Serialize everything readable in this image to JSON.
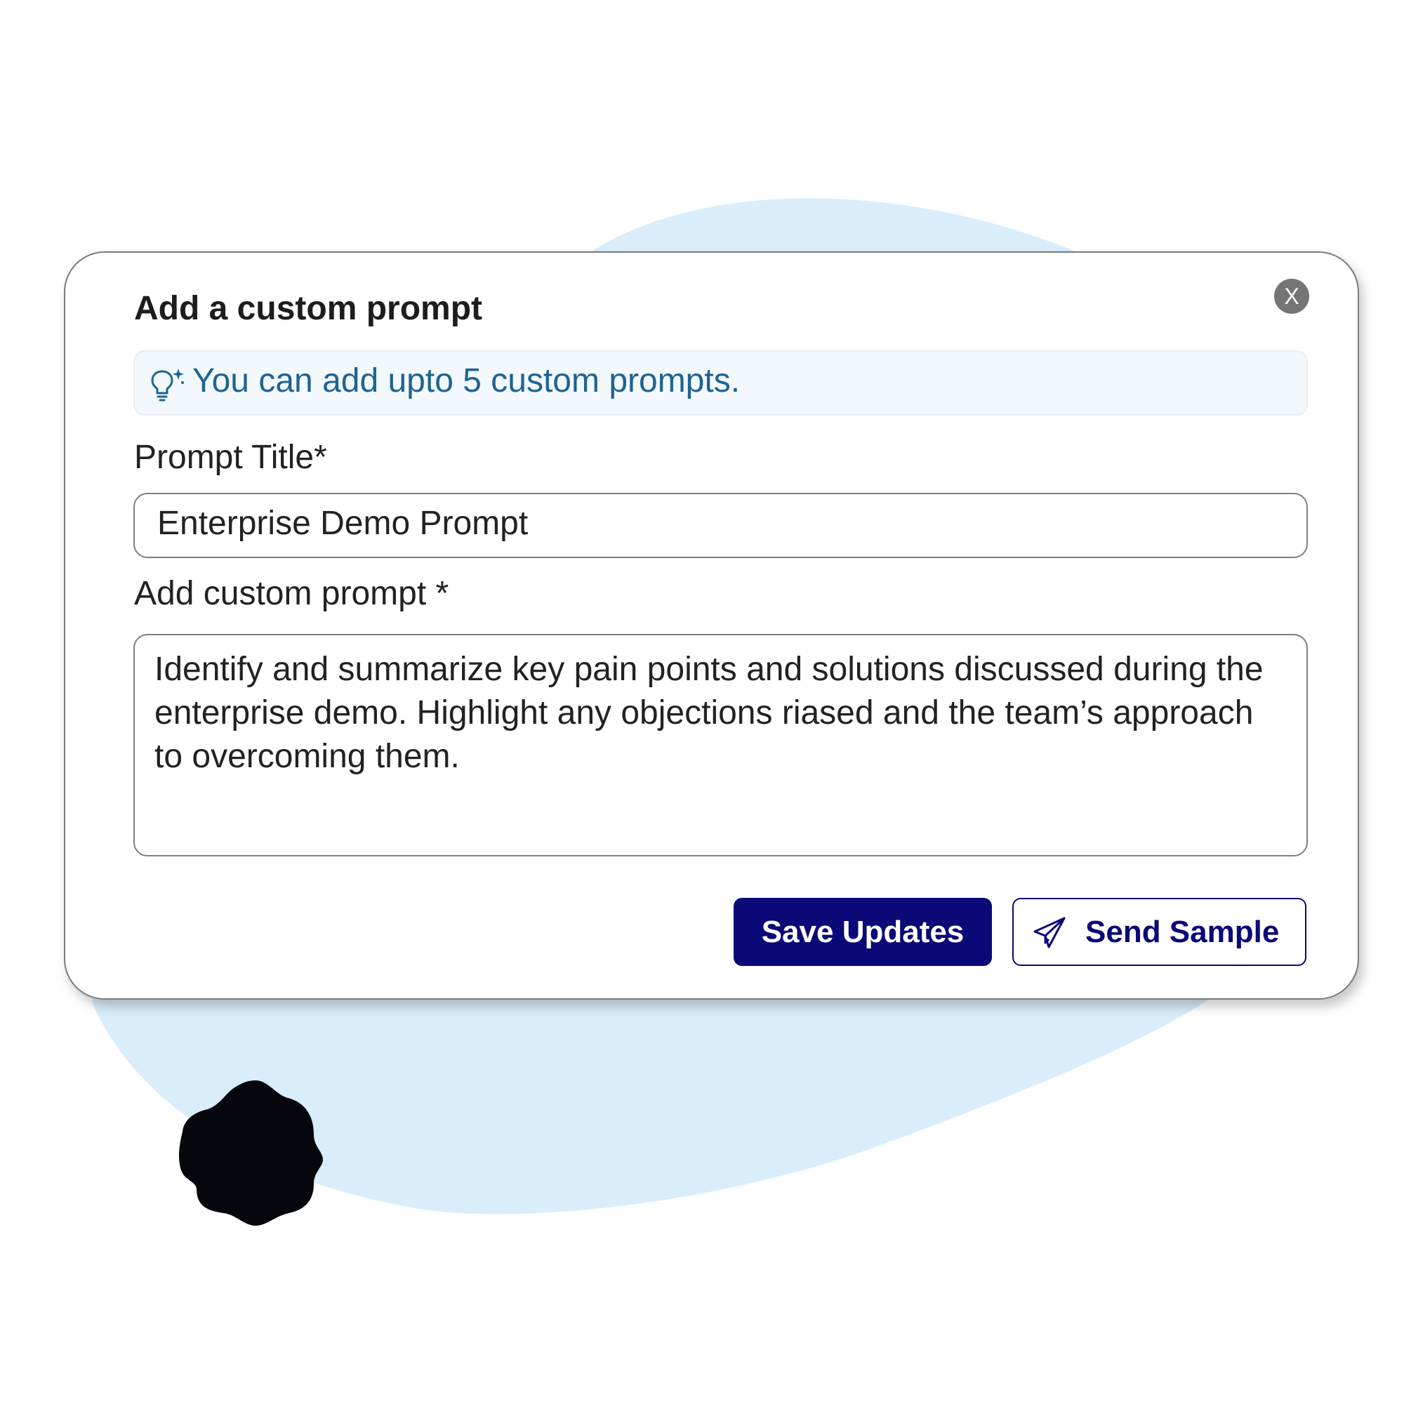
{
  "dialog": {
    "title": "Add a custom prompt",
    "close_label": "X",
    "info": {
      "icon": "lightbulb-sparkle-icon",
      "text": "You can add upto 5 custom prompts."
    },
    "fields": {
      "title_label": "Prompt Title*",
      "title_value": "Enterprise Demo Prompt",
      "prompt_label": "Add custom prompt *",
      "prompt_value": "Identify and summarize key pain points and solutions discussed during the enterprise demo. Highlight any objections riased and the team’s approach to overcoming them."
    },
    "buttons": {
      "save_label": "Save Updates",
      "send_label": "Send Sample",
      "send_icon": "paper-plane-icon"
    }
  },
  "colors": {
    "primary": "#0b0878",
    "info_text": "#1f6390",
    "info_bg": "#f2f8fc",
    "backdrop_blob": "#d9edfb",
    "close_bg": "#757575"
  }
}
